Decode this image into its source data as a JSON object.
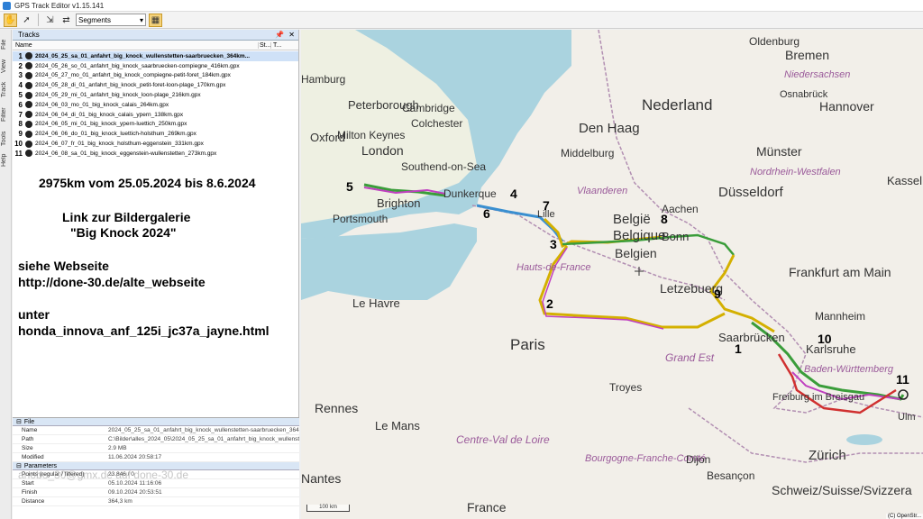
{
  "window": {
    "title": "GPS Track Editor v1.15.141"
  },
  "toolbar": {
    "segments_label": "Segments"
  },
  "side_tabs": [
    "File",
    "View",
    "Track",
    "Filter",
    "Tools",
    "Help"
  ],
  "tracks_panel": {
    "title": "Tracks",
    "columns": {
      "name": "Name",
      "status": "St...",
      "t": "T..."
    },
    "tracks": [
      {
        "num": "1",
        "name": "2024_05_25_sa_01_anfahrt_big_knock_wullenstetten-saarbruecken_364km..."
      },
      {
        "num": "2",
        "name": "2024_05_26_so_01_anfahrt_big_knock_saarbruecken-compiegne_416km.gpx"
      },
      {
        "num": "3",
        "name": "2024_05_27_mo_01_anfahrt_big_knock_compiegne-petit-foret_184km.gpx"
      },
      {
        "num": "4",
        "name": "2024_05_28_di_01_anfahrt_big_knock_petit-foret-loon-plage_170km.gpx"
      },
      {
        "num": "5",
        "name": "2024_05_29_mi_01_anfahrt_big_knock_loon-plage_216km.gpx"
      },
      {
        "num": "6",
        "name": "2024_06_03_mo_01_big_knock_calais_264km.gpx"
      },
      {
        "num": "7",
        "name": "2024_06_04_di_01_big_knock_calais_ypern_138km.gpx"
      },
      {
        "num": "8",
        "name": "2024_06_05_mi_01_big_knock_ypern-luettich_250km.gpx"
      },
      {
        "num": "9",
        "name": "2024_06_06_do_01_big_knock_luettich-holsthum_269km.gpx"
      },
      {
        "num": "10",
        "name": "2024_06_07_fr_01_big_knock_holsthum-eggenstein_331km.gpx"
      },
      {
        "num": "11",
        "name": "2024_06_08_sa_01_big_knock_eggenstein-wullenstetten_273km.gpx"
      }
    ]
  },
  "notes": {
    "summary": "2975km vom 25.05.2024 bis 8.6.2024",
    "link_line1": "Link zur Bildergalerie",
    "link_line2": "\"Big Knock 2024\"",
    "website_label": "siehe Webseite",
    "website_url": "http://done-30.de/alte_webseite",
    "unter": "unter",
    "page": "honda_innova_anf_125i_jc37a_jayne.html"
  },
  "properties": {
    "file_group": "File",
    "file_rows": [
      {
        "k": "Name",
        "v": "2024_05_25_sa_01_anfahrt_big_knock_wullenstetten-saarbruecken_364..."
      },
      {
        "k": "Path",
        "v": "C:\\Bilder\\alles_2024_05\\2024_05_25_sa_01_anfahrt_big_knock_wullenstette..."
      },
      {
        "k": "Size",
        "v": "2.9 MB"
      },
      {
        "k": "Modified",
        "v": "11.06.2024 20:58:17"
      }
    ],
    "param_group": "Parameters",
    "param_rows": [
      {
        "k": "Points (regular / filtered)",
        "v": "23.846 / 0"
      },
      {
        "k": "Start",
        "v": "05.10.2024 11:16:06"
      },
      {
        "k": "Finish",
        "v": "09.10.2024 20:53:51"
      },
      {
        "k": "Distance",
        "v": "364,3 km"
      }
    ]
  },
  "watermark": "anobo_30@gmx.de auf done-30.de",
  "map": {
    "scale": "100 km",
    "attribution": "(C) OpenStr...",
    "labels": [
      "Hamburg",
      "Oldenburg",
      "Bremen",
      "Niedersachsen",
      "Osnabrück",
      "Hannover",
      "Peterborough",
      "Milton Keynes",
      "Cambridge",
      "Colchester",
      "Oxford",
      "London",
      "Southend-on-Sea",
      "Brighton",
      "Portsmouth",
      "Den Haag",
      "Nederland",
      "Middelburg",
      "Münster",
      "Nordrhein-Westfalen",
      "Dunkerque",
      "Vlaanderen",
      "Düsseldorf",
      "Kassel",
      "Lille",
      "België",
      "Belgique",
      "Belgien",
      "Aachen",
      "Bonn",
      "Hauts-de-France",
      "Letzebuerg",
      "Frankfurt am Main",
      "Le Havre",
      "Paris",
      "Saarbrücken",
      "Mannheim",
      "Karlsruhe",
      "Grand Est",
      "Baden-Württemberg",
      "Rennes",
      "Le Mans",
      "Troyes",
      "Centre-Val de Loire",
      "Freiburg im Breisgau",
      "Ulm",
      "Bourgogne-Franche-Comté",
      "Dijon",
      "Zürich",
      "Besançon",
      "Schweiz/Suisse/Svizzera",
      "France",
      "Nantes"
    ],
    "track_numbers": [
      "1",
      "2",
      "3",
      "4",
      "5",
      "6",
      "7",
      "8",
      "9",
      "10",
      "11"
    ]
  }
}
